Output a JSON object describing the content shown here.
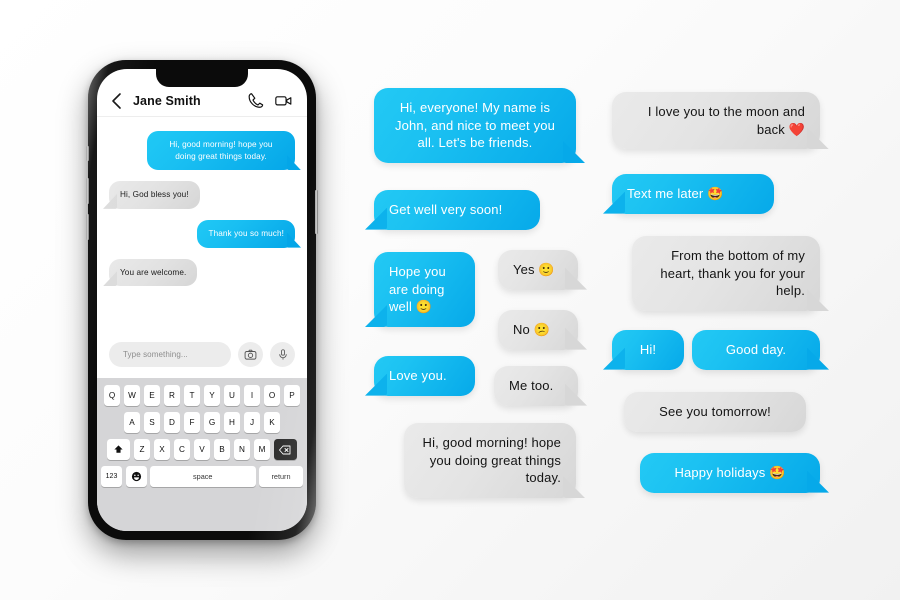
{
  "background": {
    "color_start": "#ffffff",
    "color_end": "#f1f1f1"
  },
  "theme": {
    "blue_light": "#23C9F4",
    "blue_dark": "#06A9E9",
    "gray_light": "#EAEAEA",
    "gray_dark": "#D7D7D7",
    "text_on_blue": "#ffffff",
    "text_on_gray": "#141414"
  },
  "phone": {
    "header": {
      "back_icon": "chevron-left-icon",
      "title": "Jane Smith",
      "call_icon": "phone-icon",
      "video_icon": "video-camera-icon"
    },
    "messages": [
      {
        "side": "out",
        "type": "blue",
        "text": "Hi, good morning! hope you doing great things today."
      },
      {
        "side": "in",
        "type": "gray",
        "text": "Hi, God bless you!"
      },
      {
        "side": "out",
        "type": "blue",
        "text": "Thank you so much!"
      },
      {
        "side": "in",
        "type": "gray",
        "text": "You are welcome."
      }
    ],
    "input_bar": {
      "placeholder": "Type something...",
      "camera_icon": "camera-icon",
      "mic_icon": "microphone-icon"
    },
    "keyboard": {
      "row1": [
        "Q",
        "W",
        "E",
        "R",
        "T",
        "Y",
        "U",
        "I",
        "O",
        "P"
      ],
      "row2": [
        "A",
        "S",
        "D",
        "F",
        "G",
        "H",
        "J",
        "K"
      ],
      "row3_shift": "shift-icon",
      "row3": [
        "Z",
        "X",
        "C",
        "V",
        "B",
        "N",
        "M"
      ],
      "row3_backspace": "backspace-icon",
      "row4_numbers": "123",
      "row4_emoji": "emoji-icon",
      "row4_space": "space",
      "row4_return": "return"
    }
  },
  "middle_column": [
    {
      "id": "intro",
      "type": "blue",
      "align": "center",
      "tail": "right",
      "text": "Hi, everyone! My name is John, and nice to meet you all. Let's be friends."
    },
    {
      "id": "get-well",
      "type": "blue",
      "align": "left",
      "tail": "left",
      "text": "Get well very soon!"
    },
    {
      "id": "hope-well",
      "type": "blue",
      "align": "left",
      "tail": "left",
      "text": "Hope you are doing well 🙂"
    },
    {
      "id": "yes",
      "type": "gray",
      "align": "left",
      "tail": "right",
      "text": "Yes 🙂"
    },
    {
      "id": "no",
      "type": "gray",
      "align": "left",
      "tail": "right",
      "text": "No 😕"
    },
    {
      "id": "love-you",
      "type": "blue",
      "align": "left",
      "tail": "left",
      "text": "Love you."
    },
    {
      "id": "me-too",
      "type": "gray",
      "align": "left",
      "tail": "right",
      "text": "Me too."
    },
    {
      "id": "good-morning",
      "type": "gray",
      "align": "right",
      "tail": "right",
      "text": "Hi, good morning! hope you doing great things today."
    }
  ],
  "right_column": [
    {
      "id": "moon-back",
      "type": "gray",
      "align": "right",
      "tail": "right",
      "text": "I love you to the moon and back ❤️"
    },
    {
      "id": "text-later",
      "type": "blue",
      "align": "left",
      "tail": "left",
      "text": "Text me later 🤩"
    },
    {
      "id": "bottom-heart",
      "type": "gray",
      "align": "right",
      "tail": "right",
      "text": "From the bottom of my heart, thank you for your help."
    },
    {
      "id": "hi",
      "type": "blue",
      "align": "left",
      "tail": "left",
      "text": "Hi!"
    },
    {
      "id": "good-day",
      "type": "blue",
      "align": "center",
      "tail": "right",
      "text": "Good day."
    },
    {
      "id": "see-you",
      "type": "gray",
      "align": "center",
      "tail": "none",
      "text": "See you tomorrow!"
    },
    {
      "id": "holidays",
      "type": "blue",
      "align": "center",
      "tail": "right",
      "text": "Happy holidays 🤩"
    }
  ]
}
